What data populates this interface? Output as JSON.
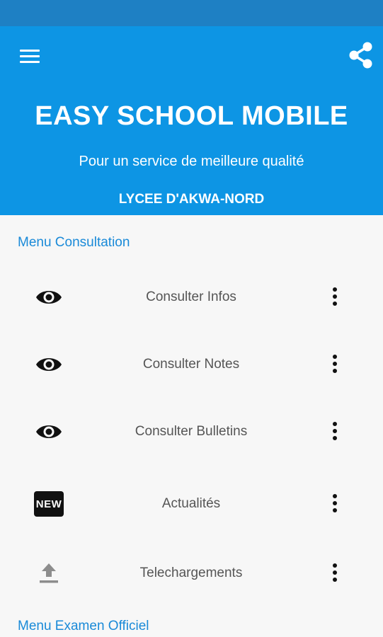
{
  "header": {
    "title": "EASY SCHOOL MOBILE",
    "subtitle": "Pour un service de meilleure qualité",
    "school": "LYCEE D'AKWA-NORD",
    "menu_icon": "hamburger-menu-icon",
    "share_icon": "share-icon"
  },
  "colors": {
    "status_bar": "#1e80c4",
    "app_bar": "#0d95e4",
    "accent": "#1a8ad8",
    "background": "#f7f7f7"
  },
  "sections": [
    {
      "title": "Menu Consultation",
      "items": [
        {
          "label": "Consulter Infos",
          "icon": "eye-icon"
        },
        {
          "label": "Consulter Notes",
          "icon": "eye-icon"
        },
        {
          "label": "Consulter Bulletins",
          "icon": "eye-icon"
        },
        {
          "label": "Actualités",
          "icon": "new-badge-icon",
          "badge": "NEW"
        },
        {
          "label": "Telechargements",
          "icon": "upload-icon"
        }
      ]
    },
    {
      "title": "Menu Examen Officiel"
    }
  ]
}
